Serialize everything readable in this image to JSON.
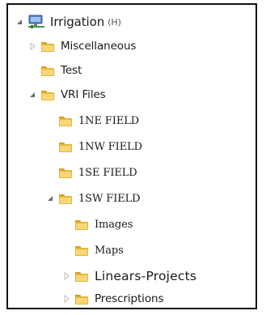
{
  "tree": {
    "root": {
      "label": "Irrigation",
      "hint": "(H)",
      "icon": "network-drive-icon",
      "expanded": true
    },
    "items": [
      {
        "label": "Miscellaneous",
        "expanded": false,
        "has_children": true
      },
      {
        "label": "Test",
        "expanded": false,
        "has_children": false
      },
      {
        "label": "VRI Files",
        "expanded": true,
        "has_children": true
      },
      {
        "label": "1NE FIELD",
        "expanded": false,
        "has_children": false
      },
      {
        "label": "1NW FIELD",
        "expanded": false,
        "has_children": false
      },
      {
        "label": "1SE FIELD",
        "expanded": false,
        "has_children": false
      },
      {
        "label": "1SW FIELD",
        "expanded": true,
        "has_children": true
      },
      {
        "label": "Images",
        "expanded": false,
        "has_children": false
      },
      {
        "label": "Maps",
        "expanded": false,
        "has_children": false
      },
      {
        "label": "Linears-Projects",
        "expanded": false,
        "has_children": true
      },
      {
        "label": "Prescriptions",
        "expanded": false,
        "has_children": true
      }
    ]
  },
  "colors": {
    "folder_body": "#e8b53a",
    "folder_tab": "#d89c22",
    "folder_light": "#f7d77a",
    "arrow_collapsed": "#bdbdbd",
    "arrow_expanded": "#6a6a6a"
  }
}
